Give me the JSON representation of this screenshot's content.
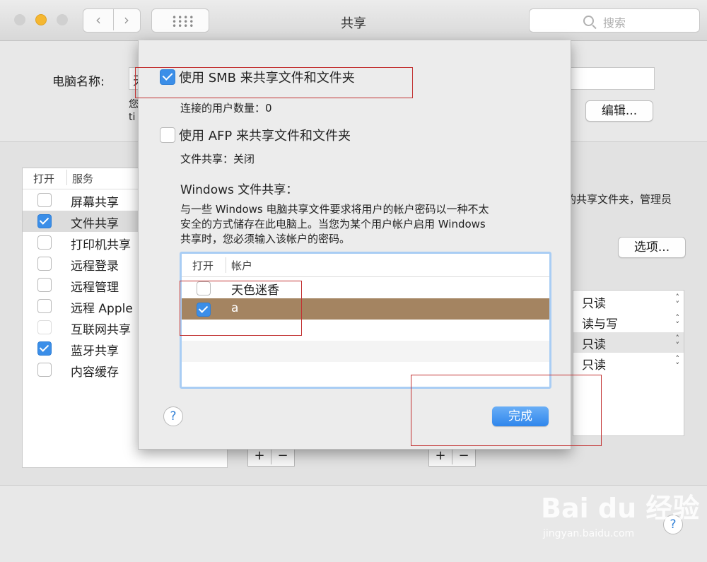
{
  "window": {
    "title": "共享",
    "search_placeholder": "搜索",
    "traffic_colors": {
      "close": "#d0d0d0",
      "minimize": "#f5b731",
      "zoom": "#d0d0d0"
    }
  },
  "computer_name": {
    "label": "电脑名称:",
    "value_partial": "天",
    "desc_line1_partial": "您",
    "desc_line2_partial": "ti",
    "edit_button": "编辑..."
  },
  "services": {
    "col_on": "打开",
    "col_service": "服务",
    "items": [
      {
        "label": "屏幕共享",
        "checked": false
      },
      {
        "label": "文件共享",
        "checked": true,
        "selected": true
      },
      {
        "label": "打印机共享",
        "checked": false
      },
      {
        "label": "远程登录",
        "checked": false
      },
      {
        "label": "远程管理",
        "checked": false
      },
      {
        "label": "远程 Apple",
        "checked": false
      },
      {
        "label": "互联网共享",
        "checked": false,
        "disabled": true
      },
      {
        "label": "蓝牙共享",
        "checked": true
      },
      {
        "label": "内容缓存",
        "checked": false
      }
    ]
  },
  "right_panel": {
    "desc_partial": "的共享文件夹，管理员",
    "options_button": "选项...",
    "permissions": [
      "只读",
      "读与写",
      "只读",
      "只读"
    ]
  },
  "sheet": {
    "smb_label": "使用 SMB 来共享文件和文件夹",
    "smb_checked": true,
    "smb_users": "连接的用户数量：0",
    "afp_label": "使用 AFP 来共享文件和文件夹",
    "afp_checked": false,
    "afp_status": "文件共享：关闭",
    "windows_title": "Windows 文件共享：",
    "windows_desc_line1": "与一些 Windows 电脑共享文件要求将用户的帐户密码以一种不太",
    "windows_desc_line2": "安全的方式储存在此电脑上。当您为某个用户帐户启用 Windows",
    "windows_desc_line3": "共享时，您必须输入该帐户的密码。",
    "table_col_on": "打开",
    "table_col_account": "帐户",
    "accounts": [
      {
        "name": "天色迷香",
        "checked": false
      },
      {
        "name": "a",
        "checked": true,
        "selected": true
      }
    ],
    "help_label": "?",
    "done_button": "完成"
  },
  "colors": {
    "accent": "#3b8ee8",
    "selected_row": "#a48461",
    "annotation_red": "#c23232"
  },
  "watermark": {
    "brand": "Bai du 经验",
    "url": "jingyan.baidu.com"
  }
}
